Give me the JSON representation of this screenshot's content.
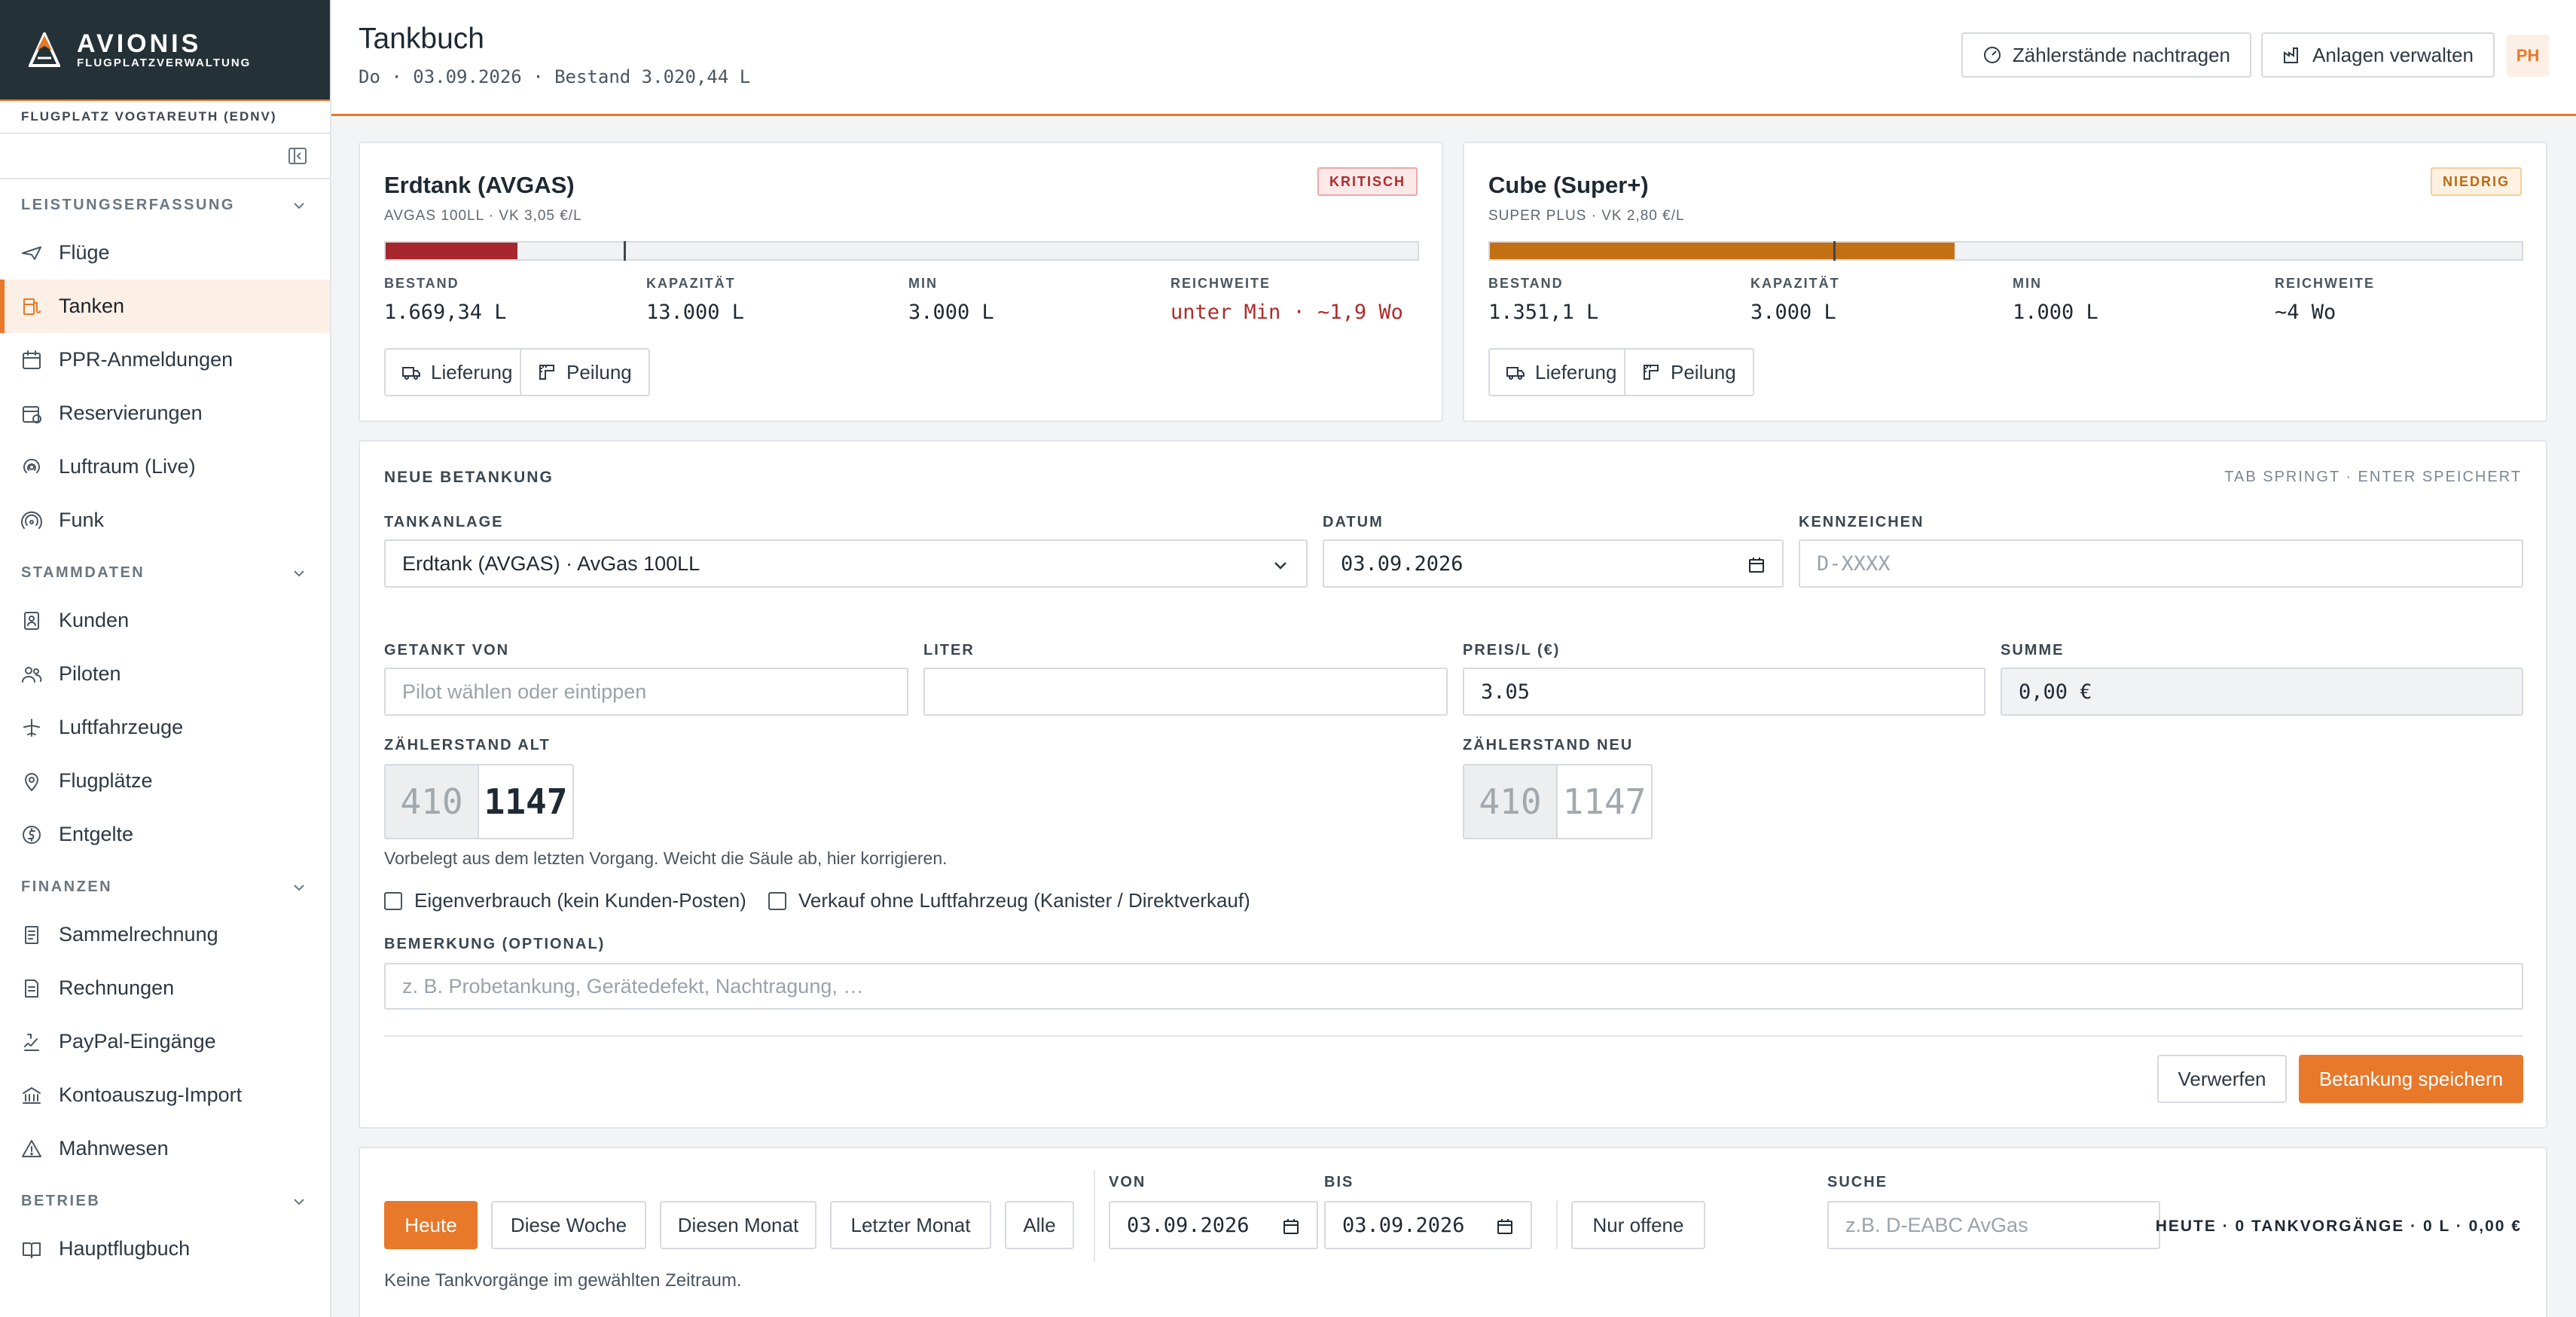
{
  "brand": {
    "name": "AVIONIS",
    "tagline": "FLUGPLATZVERWALTUNG"
  },
  "airfield": "FLUGPLATZ VOGTAREUTH (EDNV)",
  "sidebar": {
    "sections": [
      {
        "title": "LEISTUNGSERFASSUNG",
        "items": [
          "Flüge",
          "Tanken",
          "PPR-Anmeldungen",
          "Reservierungen",
          "Luftraum (Live)",
          "Funk"
        ]
      },
      {
        "title": "STAMMDATEN",
        "items": [
          "Kunden",
          "Piloten",
          "Luftfahrzeuge",
          "Flugplätze",
          "Entgelte"
        ]
      },
      {
        "title": "FINANZEN",
        "items": [
          "Sammelrechnung",
          "Rechnungen",
          "PayPal-Eingänge",
          "Kontoauszug-Import",
          "Mahnwesen"
        ]
      },
      {
        "title": "BETRIEB",
        "items": [
          "Hauptflugbuch"
        ]
      }
    ],
    "active_item": "Tanken"
  },
  "header": {
    "title": "Tankbuch",
    "subtitle": "Do · 03.09.2026 · Bestand 3.020,44 L",
    "btn_meters": "Zählerstände nachtragen",
    "btn_plants": "Anlagen verwalten",
    "avatar": "PH"
  },
  "tanks": [
    {
      "name": "Erdtank (AVGAS)",
      "meta": "AVGAS 100LL · VK 3,05 €/L",
      "badge": "KRITISCH",
      "fill_fraction": 0.128,
      "min_fraction": 0.231,
      "fill_color": "#a8262e",
      "labels": {
        "stock": "BESTAND",
        "capacity": "KAPAZITÄT",
        "min": "MIN",
        "range": "REICHWEITE"
      },
      "stock": "1.669,34 L",
      "capacity": "13.000 L",
      "min": "3.000 L",
      "range": "unter Min · ~1,9 Wo",
      "btn_delivery": "Lieferung",
      "btn_gauge": "Peilung"
    },
    {
      "name": "Cube (Super+)",
      "meta": "SUPER PLUS · VK 2,80 €/L",
      "badge": "NIEDRIG",
      "fill_fraction": 0.45,
      "min_fraction": 0.333,
      "fill_color": "#c37014",
      "labels": {
        "stock": "BESTAND",
        "capacity": "KAPAZITÄT",
        "min": "MIN",
        "range": "REICHWEITE"
      },
      "stock": "1.351,1 L",
      "capacity": "3.000 L",
      "min": "1.000 L",
      "range": "~4 Wo",
      "btn_delivery": "Lieferung",
      "btn_gauge": "Peilung"
    }
  ],
  "form": {
    "title": "NEUE BETANKUNG",
    "hint_keys": "TAB SPRINGT · ENTER SPEICHERT",
    "plant_label": "TANKANLAGE",
    "plant_value": "Erdtank (AVGAS) · AvGas 100LL",
    "date_label": "DATUM",
    "date_value": "03.09.2026",
    "reg_label": "KENNZEICHEN",
    "reg_placeholder": "D-XXXX",
    "pilot_label": "GETANKT VON",
    "pilot_placeholder": "Pilot wählen oder eintippen",
    "liters_label": "LITER",
    "liters_value": "",
    "price_label": "PREIS/L (€)",
    "price_value": "3.05",
    "sum_label": "SUMME",
    "sum_value": "0,00 €",
    "counter_old_label": "ZÄHLERSTAND ALT",
    "counter_old_prefix": "410",
    "counter_old_value": "1147",
    "counter_new_label": "ZÄHLERSTAND NEU",
    "counter_new_prefix": "410",
    "counter_new_value": "1147",
    "counter_hint": "Vorbelegt aus dem letzten Vorgang. Weicht die Säule ab, hier korrigieren.",
    "check_own": "Eigenverbrauch (kein Kunden-Posten)",
    "check_sale": "Verkauf ohne Luftfahrzeug (Kanister / Direktverkauf)",
    "remark_label": "BEMERKUNG (OPTIONAL)",
    "remark_placeholder": "z. B. Probetankung, Gerätedefekt, Nachtragung, …",
    "btn_discard": "Verwerfen",
    "btn_save": "Betankung speichern"
  },
  "filter": {
    "presets": [
      "Heute",
      "Diese Woche",
      "Diesen Monat",
      "Letzter Monat",
      "Alle"
    ],
    "active_preset": "Heute",
    "from_label": "VON",
    "from_value": "03.09.2026",
    "to_label": "BIS",
    "to_value": "03.09.2026",
    "open_only": "Nur offene",
    "search_label": "SUCHE",
    "search_placeholder": "z.B. D-EABC AvGas",
    "summary": "HEUTE · 0 TANKVORGÄNGE · 0 L · 0,00 €",
    "empty": "Keine Tankvorgänge im gewählten Zeitraum."
  },
  "colors": {
    "accent": "#e8782a",
    "sidebar_brand_bg": "#243238",
    "critical": "#b02a2a",
    "low": "#b86a10"
  }
}
